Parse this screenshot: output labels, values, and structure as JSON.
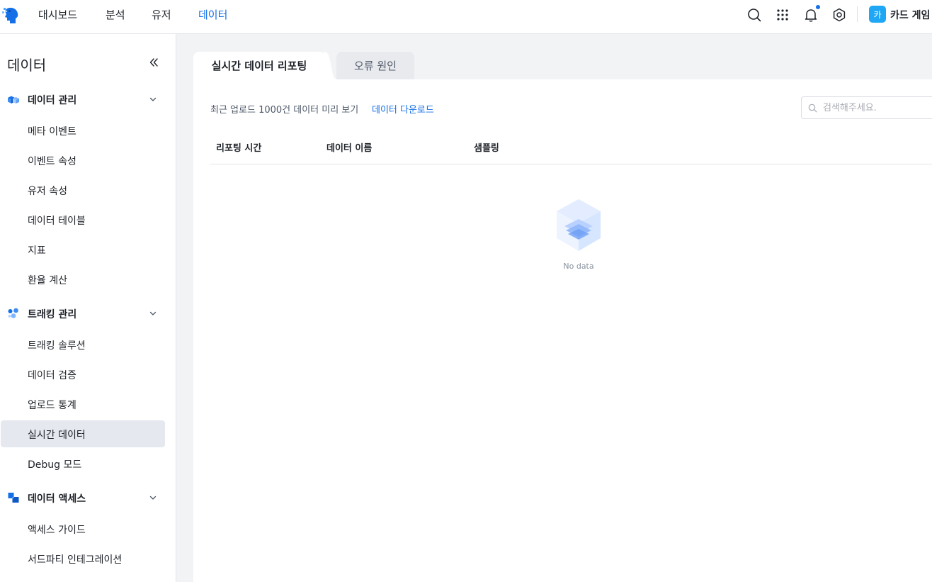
{
  "topnav": {
    "items": [
      {
        "label": "대시보드",
        "active": false
      },
      {
        "label": "분석",
        "active": false
      },
      {
        "label": "유저",
        "active": false
      },
      {
        "label": "데이터",
        "active": true
      }
    ],
    "icons": [
      "search-icon",
      "apps-grid-icon",
      "bell-icon",
      "settings-icon"
    ],
    "user": {
      "avatar_letter": "카",
      "name": "카드 게임"
    },
    "accent_color": "#1570e8"
  },
  "sidebar": {
    "title": "데이터",
    "groups": [
      {
        "label": "데이터 관리",
        "icon": "cubes-icon",
        "items": [
          "메타 이벤트",
          "이벤트 속성",
          "유저 속성",
          "데이터 테이블",
          "지표",
          "환율 계산"
        ]
      },
      {
        "label": "트래킹 관리",
        "icon": "tracking-icon",
        "items": [
          "트래킹 솔루션",
          "데이터 검증",
          "업로드 통계",
          "실시간 데이터",
          "Debug 모드"
        ]
      },
      {
        "label": "데이터 액세스",
        "icon": "access-icon",
        "items": [
          "액세스 가이드",
          "서드파티 인테그레이션"
        ]
      }
    ],
    "active_item": "실시간 데이터"
  },
  "tabs": [
    {
      "label": "실시간 데이터 리포팅",
      "active": true
    },
    {
      "label": "오류 원인",
      "active": false
    }
  ],
  "toolbar": {
    "preview_text": "최근 업로드 1000건 데이터 미리 보기",
    "download_link": "데이터 다운로드",
    "search_placeholder": "검색해주세요."
  },
  "table": {
    "columns": [
      "리포팅 시간",
      "데이터 이름",
      "샘플링"
    ],
    "rows": []
  },
  "empty_state": {
    "text": "No data"
  }
}
